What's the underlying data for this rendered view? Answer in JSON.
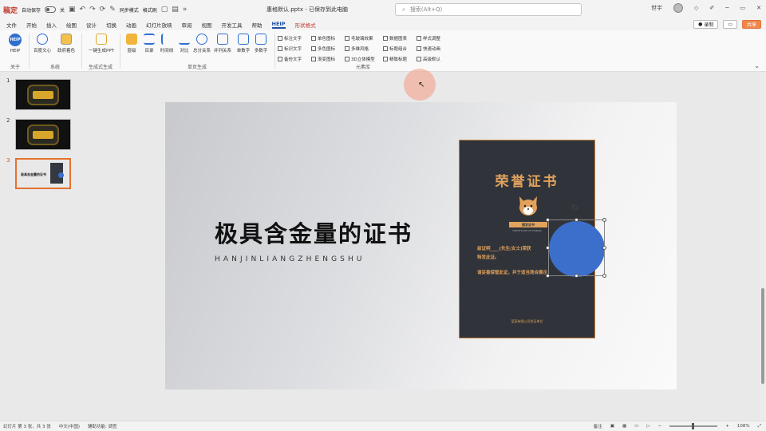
{
  "titlebar": {
    "app_logo": "稿定",
    "autosave_label": "自动保存",
    "toggle_state": "关",
    "doc_title": "惠格默认.pptx - 已保存到此电脑",
    "search_placeholder": "搜索(Alt+Q)",
    "user": "世宇",
    "quick_access": [
      "保存",
      "撤销",
      "重做",
      "同步模式",
      "格式刷",
      "新建",
      "打开"
    ]
  },
  "menubar": {
    "items": [
      "文件",
      "开始",
      "插入",
      "绘图",
      "设计",
      "切换",
      "动画",
      "幻灯片放映",
      "审阅",
      "视图",
      "开发工具",
      "帮助",
      "HEIP",
      "形状格式"
    ],
    "active": "HEIP",
    "record_label": "录制",
    "share_label": "共享"
  },
  "ribbon": {
    "groups": [
      {
        "label": "关于",
        "buttons": [
          "HEIP"
        ]
      },
      {
        "label": "系统",
        "buttons": [
          "百度文心",
          "政府着色"
        ]
      },
      {
        "label": "生成式生成",
        "buttons": [
          "一键生成PPT"
        ]
      },
      {
        "label": "单页生成",
        "buttons": [
          "层级",
          "目录",
          "时间线",
          "对比",
          "总分关系",
          "并列关系",
          "单数字",
          "多数字"
        ]
      },
      {
        "label": "元素库",
        "checks": [
          "标注文字",
          "单色图标",
          "毛玻璃效果",
          "数据图表",
          "样式调整",
          "标识文字",
          "多色图标",
          "多维风格",
          "标题组合",
          "快速动画",
          "备份文字",
          "渐变图标",
          "3D立体模型",
          "精致标题",
          "高级默认"
        ]
      }
    ]
  },
  "thumbnails": {
    "numbers": [
      "1",
      "2",
      "3"
    ],
    "active": 3,
    "slide3_title": "极具含金量的证书"
  },
  "slide": {
    "title": "极具含金量的证书",
    "subtitle": "HANJINLIANGZHENGSHU",
    "certificate": {
      "title": "荣誉证书",
      "badge": "颁发证书",
      "badge_en": "CERTIFICATE OF HONOR",
      "line1": "兹证明____(先生/女士)荣获",
      "line2": "特发此证。",
      "line3": "请妥善保管此证，并于适当场合展示",
      "footer": "某某有限公司发证单位"
    },
    "shape_color": "#3b6fcb"
  },
  "statusbar": {
    "slide_info": "幻灯片 第 3 张，共 3 张",
    "language": "中文(中国)",
    "accessibility": "辅助功能: 调查",
    "notes": "备注",
    "zoom": "108%"
  },
  "colors": {
    "accent": "#1f4fa8",
    "cert_gold": "#e2a25c",
    "cert_bg": "#30343a",
    "share_orange": "#f0864a"
  }
}
